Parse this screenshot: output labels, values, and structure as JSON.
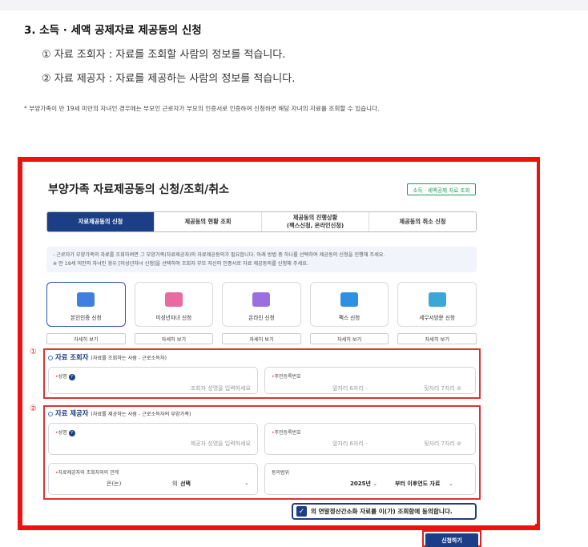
{
  "section": {
    "title": "3.  소득 · 세액 공제자료 제공동의 신청",
    "step1": "① 자료 조회자 : 자료를 조회할 사람의 정보를 적습니다.",
    "step2": "② 자료 제공자 : 자료를 제공하는 사람의 정보를 적습니다.",
    "note": "* 부양가족이 만 19세 미만의 자녀인 경우에는 부모인 근로자가 부모의 인증서로 인증하여 신청하면 해당 자녀의 자료를 조회할 수 있습니다."
  },
  "panel": {
    "title": "부양가족 자료제공동의 신청/조회/취소",
    "tag": "소득 · 세액공제 자료 조회",
    "tabs": [
      {
        "label": "자료제공동의 신청"
      },
      {
        "label": "제공동의 현황 조회"
      },
      {
        "label": "제공동의 진행상황\n(팩스신청, 온라인신청)"
      },
      {
        "label": "제공동의 취소 신청"
      }
    ],
    "info_line1": "- 근로자가 부양가족의 자료를 조회하려면 그 부양가족(자료제공자)의 자료제공동의가 필요합니다. 아래 방법 중 하나를 선택하여 제공동의 신청을 진행해 주세요.",
    "info_line2": "※ 만 19세 미만의 자녀인 경우 [미성년자녀 신청]을 선택하여 조회자 부모 자신의 인증서로 자료 제공동의를 신청해 주세요.",
    "methods": [
      {
        "label": "본인인증 신청",
        "detail": "자세히 보기",
        "icon": "id-card-icon",
        "color": "#3f7fe0"
      },
      {
        "label": "미성년자녀 신청",
        "detail": "자세히 보기",
        "icon": "child-icon",
        "color": "#e86aa0"
      },
      {
        "label": "온라인 신청",
        "detail": "자세히 보기",
        "icon": "monitor-icon",
        "color": "#9b6fe0"
      },
      {
        "label": "팩스 신청",
        "detail": "자세히 보기",
        "icon": "fax-icon",
        "color": "#2f8fe0"
      },
      {
        "label": "세무서방문 신청",
        "detail": "자세히 보기",
        "icon": "office-icon",
        "color": "#3aa7d8"
      }
    ]
  },
  "viewer": {
    "num": "①",
    "title": "자료 조회자",
    "subtitle": "(자료를 조회하는 사람 - 근로소득자)",
    "name_label": "성명",
    "name_placeholder": "조회자 성명을 입력하세요",
    "rrn_label": "주민등록번호",
    "rrn_front": "앞자리 6자리",
    "rrn_back": "뒷자리 7자리"
  },
  "provider": {
    "num": "②",
    "title": "자료 제공자",
    "subtitle": "(자료를 제공하는 사람 - 근로소득자의 부양가족)",
    "name_label": "성명",
    "name_placeholder": "제공자 성명을 입력하세요",
    "rrn_label": "주민등록번호",
    "rrn_front": "앞자리 6자리",
    "rrn_back": "뒷자리 7자리",
    "relation_label": "자료제공자와 조회자와의 관계",
    "relation_prefix": "은(는)",
    "relation_mid": "의",
    "relation_value": "선택",
    "scope_label": "동의범위",
    "scope_year": "2025년",
    "scope_value": "부터 이후연도 자료"
  },
  "agree": {
    "label": "의 연말정산간소화 자료를 이(가) 조회함에 동의합니다.",
    "checked": true
  },
  "apply_label": "신청하기"
}
